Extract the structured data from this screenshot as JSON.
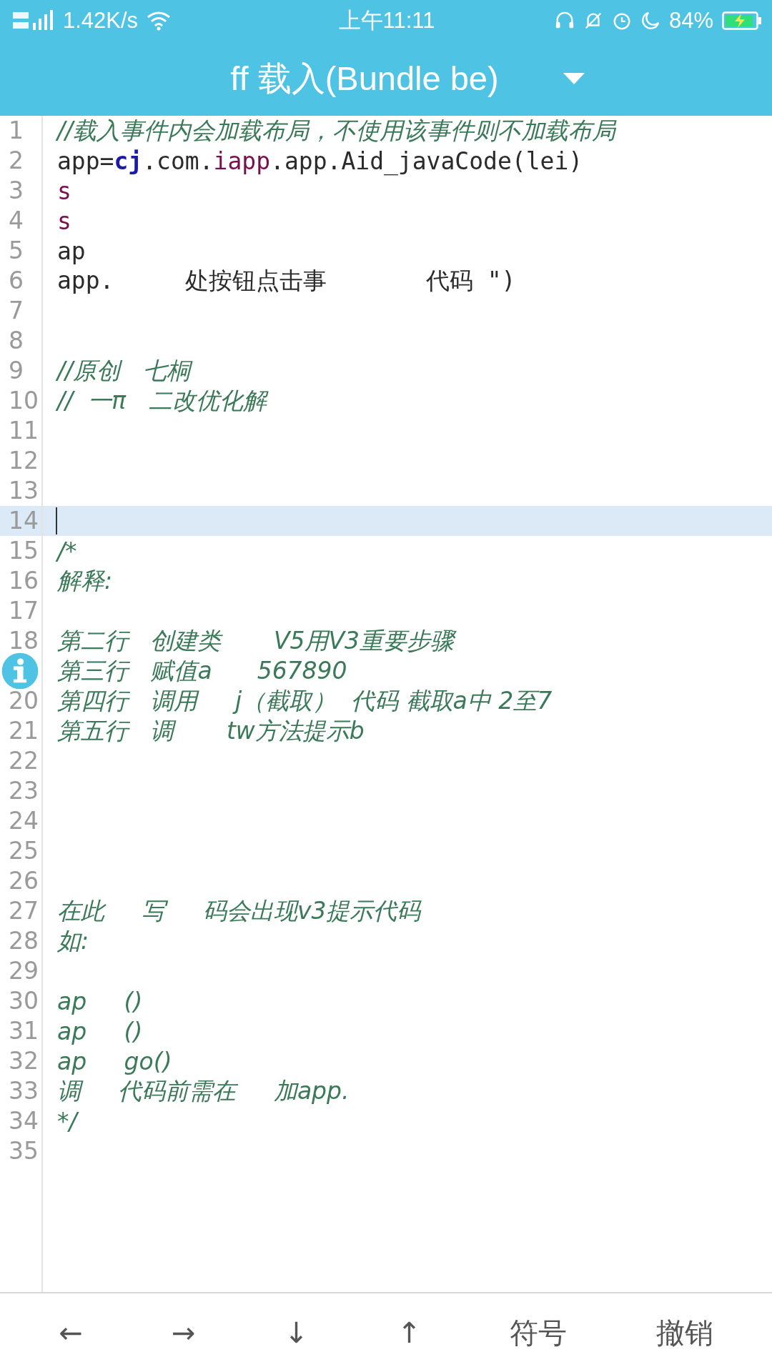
{
  "status_bar": {
    "network": "1.42K/s",
    "time": "上午11:11",
    "battery": "84%",
    "charging": true
  },
  "title_bar": {
    "title": "ff 载入(Bundle be)"
  },
  "editor": {
    "lines": [
      {
        "number": "1",
        "current": false,
        "tokens": [
          {
            "text": "//载入事件内会加载布局，不使用该事件则不加载布局",
            "kind": "comment"
          }
        ]
      },
      {
        "number": "2",
        "current": false,
        "tokens": [
          {
            "text": "app=",
            "kind": "plain"
          },
          {
            "text": "cj",
            "kind": "keyword"
          },
          {
            "text": ".com.",
            "kind": "plain"
          },
          {
            "text": "iapp",
            "kind": "package"
          },
          {
            "text": ".app.Aid_javaCode(lei)",
            "kind": "plain"
          }
        ]
      },
      {
        "number": "3",
        "current": false,
        "tokens": [
          {
            "text": "s",
            "kind": "package"
          }
        ]
      },
      {
        "number": "4",
        "current": false,
        "tokens": [
          {
            "text": "s",
            "kind": "package"
          }
        ]
      },
      {
        "number": "5",
        "current": false,
        "tokens": [
          {
            "text": "ap",
            "kind": "plain"
          }
        ]
      },
      {
        "number": "6",
        "current": false,
        "tokens": [
          {
            "text": "app.     处按钮点击事       代码 \")",
            "kind": "plain"
          }
        ]
      },
      {
        "number": "7",
        "current": false
      },
      {
        "number": "8",
        "current": false
      },
      {
        "number": "9",
        "current": false,
        "tokens": [
          {
            "text": "//原创   七桐",
            "kind": "comment"
          }
        ]
      },
      {
        "number": "10",
        "current": false,
        "tokens": [
          {
            "text": "//  一π   二改优化解",
            "kind": "comment"
          }
        ]
      },
      {
        "number": "11",
        "current": false
      },
      {
        "number": "12",
        "current": false
      },
      {
        "number": "13",
        "current": false
      },
      {
        "number": "14",
        "current": true
      },
      {
        "number": "15",
        "current": false,
        "tokens": [
          {
            "text": "/*",
            "kind": "comment"
          }
        ]
      },
      {
        "number": "16",
        "current": false,
        "tokens": [
          {
            "text": "解释:",
            "kind": "comment"
          }
        ]
      },
      {
        "number": "17",
        "current": false
      },
      {
        "number": "18",
        "current": false,
        "tokens": [
          {
            "text": "第二行   创建类       V5用V3重要步骤",
            "kind": "comment"
          }
        ]
      },
      {
        "current": false,
        "tokens": [
          {
            "text": "第三行   赋值a      567890",
            "kind": "comment"
          }
        ]
      },
      {
        "number": "20",
        "current": false,
        "tokens": [
          {
            "text": "第四行   调用     j（截取）  代码 截取a中 2至7",
            "kind": "comment"
          }
        ]
      },
      {
        "number": "21",
        "current": false,
        "tokens": [
          {
            "text": "第五行   调       tw方法提示b",
            "kind": "comment"
          }
        ]
      },
      {
        "number": "22",
        "current": false
      },
      {
        "number": "23",
        "current": false
      },
      {
        "number": "24",
        "current": false
      },
      {
        "number": "25",
        "current": false
      },
      {
        "number": "26",
        "current": false
      },
      {
        "number": "27",
        "current": false,
        "tokens": [
          {
            "text": "在此     写     码会出现v3提示代码",
            "kind": "comment"
          }
        ]
      },
      {
        "number": "28",
        "current": false,
        "tokens": [
          {
            "text": "如:",
            "kind": "comment"
          }
        ]
      },
      {
        "number": "29",
        "current": false
      },
      {
        "number": "30",
        "current": false,
        "tokens": [
          {
            "text": "ap     ()",
            "kind": "comment"
          }
        ]
      },
      {
        "number": "31",
        "current": false,
        "tokens": [
          {
            "text": "ap     ()",
            "kind": "comment"
          }
        ]
      },
      {
        "number": "32",
        "current": false,
        "tokens": [
          {
            "text": "ap     go()",
            "kind": "comment"
          }
        ]
      },
      {
        "number": "33",
        "current": false,
        "tokens": [
          {
            "text": "调     代码前需在     加app.",
            "kind": "comment"
          }
        ]
      },
      {
        "number": "34",
        "current": false,
        "tokens": [
          {
            "text": "*/",
            "kind": "comment"
          }
        ]
      },
      {
        "number": "35",
        "current": false
      }
    ]
  },
  "toolbar": [
    {
      "label": "←"
    },
    {
      "label": "→"
    },
    {
      "label": "↓"
    },
    {
      "label": "↑"
    },
    {
      "label": "符号"
    },
    {
      "label": "撤销"
    }
  ]
}
